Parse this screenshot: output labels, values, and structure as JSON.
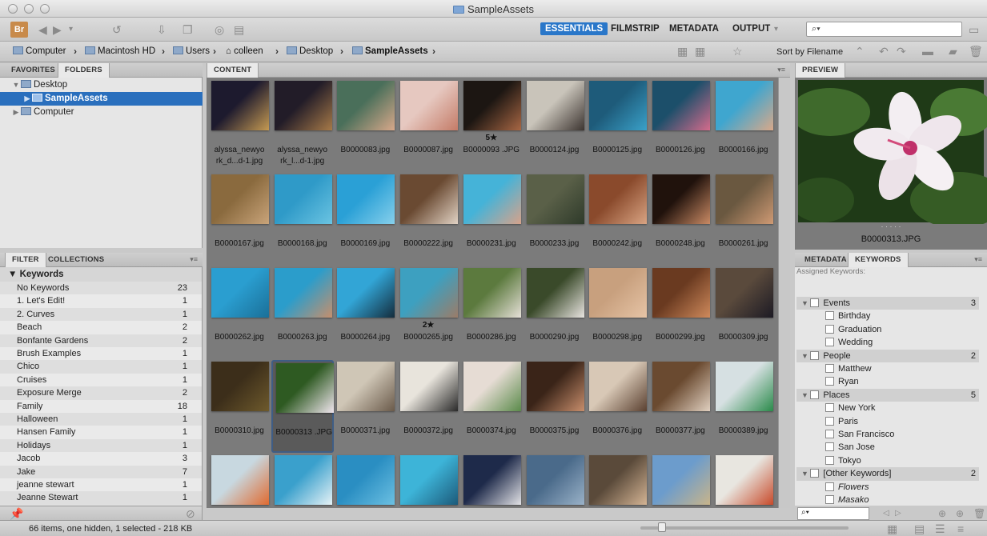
{
  "window": {
    "title": "SampleAssets"
  },
  "toolbar": {
    "workspaces": [
      "ESSENTIALS",
      "FILMSTRIP",
      "METADATA",
      "OUTPUT"
    ],
    "active_workspace": "ESSENTIALS",
    "search_placeholder": "⌕▾",
    "logo": "Br"
  },
  "path": {
    "crumbs": [
      "Computer",
      "Macintosh HD",
      "Users",
      "colleen",
      "Desktop",
      "SampleAssets"
    ],
    "sort_label": "Sort by Filename"
  },
  "left_top": {
    "tabs": [
      "FAVORITES",
      "FOLDERS"
    ],
    "active_tab": "FOLDERS",
    "tree": [
      {
        "label": "Desktop",
        "depth": 1,
        "expanded": true
      },
      {
        "label": "SampleAssets",
        "depth": 2,
        "selected": true
      },
      {
        "label": "Computer",
        "depth": 1,
        "expanded": false
      }
    ]
  },
  "left_bottom": {
    "tabs": [
      "FILTER",
      "COLLECTIONS"
    ],
    "active_tab": "FILTER",
    "heading": "Keywords",
    "rows": [
      {
        "label": "No Keywords",
        "count": "23"
      },
      {
        "label": "1. Let's Edit!",
        "count": "1"
      },
      {
        "label": "2. Curves",
        "count": "1"
      },
      {
        "label": "Beach",
        "count": "2"
      },
      {
        "label": "Bonfante Gardens",
        "count": "2"
      },
      {
        "label": "Brush Examples",
        "count": "1"
      },
      {
        "label": "Chico",
        "count": "1"
      },
      {
        "label": "Cruises",
        "count": "1"
      },
      {
        "label": "Exposure Merge",
        "count": "2"
      },
      {
        "label": "Family",
        "count": "18"
      },
      {
        "label": "Halloween",
        "count": "1"
      },
      {
        "label": "Hansen Family",
        "count": "1"
      },
      {
        "label": "Holidays",
        "count": "1"
      },
      {
        "label": "Jacob",
        "count": "3"
      },
      {
        "label": "Jake",
        "count": "7"
      },
      {
        "label": "jeanne stewart",
        "count": "1"
      },
      {
        "label": "Jeanne Stewart",
        "count": "1"
      }
    ]
  },
  "content": {
    "tab": "CONTENT",
    "items": [
      {
        "name": "alyssa_newyo rk_d...d-1.jpg",
        "colors": [
          "#1d1a2e",
          "#c59a52"
        ],
        "stars": ""
      },
      {
        "name": "alyssa_newyo rk_l...d-1.jpg",
        "colors": [
          "#221c28",
          "#a77a48"
        ],
        "stars": ""
      },
      {
        "name": "B0000083.jpg",
        "colors": [
          "#4a6f5a",
          "#d8a88a"
        ],
        "stars": ""
      },
      {
        "name": "B0000087.jpg",
        "colors": [
          "#e6c8c0",
          "#c47b67"
        ],
        "stars": ""
      },
      {
        "name": "B0000093 .JPG",
        "colors": [
          "#1c1612",
          "#a86744"
        ],
        "stars": "5★"
      },
      {
        "name": "B0000124.jpg",
        "colors": [
          "#c9c4ba",
          "#3c3430"
        ],
        "stars": ""
      },
      {
        "name": "B0000125.jpg",
        "colors": [
          "#1e5b7a",
          "#3aa1c9"
        ],
        "stars": ""
      },
      {
        "name": "B0000126.jpg",
        "colors": [
          "#1c4f6a",
          "#d46b8c"
        ],
        "stars": ""
      },
      {
        "name": "B0000166.jpg",
        "colors": [
          "#3fa6cf",
          "#d9a889"
        ],
        "stars": ""
      },
      {
        "name": "B0000167.jpg",
        "colors": [
          "#8a6a3e",
          "#c9a47a"
        ],
        "stars": ""
      },
      {
        "name": "B0000168.jpg",
        "colors": [
          "#2f9ac8",
          "#6bc4e2"
        ],
        "stars": ""
      },
      {
        "name": "B0000169.jpg",
        "colors": [
          "#2aa0d6",
          "#87d0ec"
        ],
        "stars": ""
      },
      {
        "name": "B0000222.jpg",
        "colors": [
          "#6a4a32",
          "#e1d2c4"
        ],
        "stars": ""
      },
      {
        "name": "B0000231.jpg",
        "colors": [
          "#45b3d8",
          "#d7a28a"
        ],
        "stars": ""
      },
      {
        "name": "B0000233.jpg",
        "colors": [
          "#5a6048",
          "#2e3a2a"
        ],
        "stars": ""
      },
      {
        "name": "B0000242.jpg",
        "colors": [
          "#8a4a2c",
          "#d9a483"
        ],
        "stars": ""
      },
      {
        "name": "B0000248.jpg",
        "colors": [
          "#20120c",
          "#c98a64"
        ],
        "stars": ""
      },
      {
        "name": "B0000261.jpg",
        "colors": [
          "#6a5840",
          "#cf9a74"
        ],
        "stars": ""
      },
      {
        "name": "B0000262.jpg",
        "colors": [
          "#2a9ed0",
          "#1a6f98"
        ],
        "stars": ""
      },
      {
        "name": "B0000263.jpg",
        "colors": [
          "#2b9dcb",
          "#c68f6c"
        ],
        "stars": ""
      },
      {
        "name": "B0000264.jpg",
        "colors": [
          "#32a5d6",
          "#142c3c"
        ],
        "stars": ""
      },
      {
        "name": "B0000265.jpg",
        "colors": [
          "#3da0c0",
          "#9b7c68"
        ],
        "stars": "2★"
      },
      {
        "name": "B0000286.jpg",
        "colors": [
          "#5c7a3e",
          "#e6e0d8"
        ],
        "stars": ""
      },
      {
        "name": "B0000290.jpg",
        "colors": [
          "#3a4a2a",
          "#e8e4e0"
        ],
        "stars": ""
      },
      {
        "name": "B0000298.jpg",
        "colors": [
          "#c8a07e",
          "#e6c4a6"
        ],
        "stars": ""
      },
      {
        "name": "B0000299.jpg",
        "colors": [
          "#6a3a20",
          "#cf8a5c"
        ],
        "stars": ""
      },
      {
        "name": "B0000309.jpg",
        "colors": [
          "#5a4a3c",
          "#1c1a24"
        ],
        "stars": ""
      },
      {
        "name": "B0000310.jpg",
        "colors": [
          "#3c2e1a",
          "#6e5a2c"
        ],
        "stars": ""
      },
      {
        "name": "B0000313 .JPG",
        "colors": [
          "#2e5a22",
          "#f0e6ee"
        ],
        "stars": "",
        "selected": true
      },
      {
        "name": "B0000371.jpg",
        "colors": [
          "#cfc6b6",
          "#6a5a4a"
        ],
        "stars": ""
      },
      {
        "name": "B0000372.jpg",
        "colors": [
          "#e8e4dc",
          "#2a2a2a"
        ],
        "stars": ""
      },
      {
        "name": "B0000374.jpg",
        "colors": [
          "#e6dcd4",
          "#5a8a4a"
        ],
        "stars": ""
      },
      {
        "name": "B0000375.jpg",
        "colors": [
          "#3a2418",
          "#c88e6c"
        ],
        "stars": ""
      },
      {
        "name": "B0000376.jpg",
        "colors": [
          "#d8c8b6",
          "#5a4030"
        ],
        "stars": ""
      },
      {
        "name": "B0000377.jpg",
        "colors": [
          "#6a4a30",
          "#e0d0c0"
        ],
        "stars": ""
      },
      {
        "name": "B0000389.jpg",
        "colors": [
          "#d6e0e2",
          "#2a8a4a"
        ],
        "stars": ""
      },
      {
        "name": "",
        "colors": [
          "#c8d8e0",
          "#e06a30"
        ],
        "stars": ""
      },
      {
        "name": "",
        "colors": [
          "#3aa0cc",
          "#e6f2f6"
        ],
        "stars": ""
      },
      {
        "name": "",
        "colors": [
          "#2a8ec2",
          "#6cc0e2"
        ],
        "stars": ""
      },
      {
        "name": "",
        "colors": [
          "#3db4d8",
          "#1c5a7a"
        ],
        "stars": ""
      },
      {
        "name": "",
        "colors": [
          "#1e2a4a",
          "#e2e2e6"
        ],
        "stars": ""
      },
      {
        "name": "",
        "colors": [
          "#4a6a8a",
          "#9ab2c8"
        ],
        "stars": ""
      },
      {
        "name": "",
        "colors": [
          "#5a4a3a",
          "#d4b494"
        ],
        "stars": ""
      },
      {
        "name": "",
        "colors": [
          "#6c9ccc",
          "#c8b48a"
        ],
        "stars": ""
      },
      {
        "name": "",
        "colors": [
          "#e8e6e0",
          "#c84a2a"
        ],
        "stars": ""
      }
    ]
  },
  "preview": {
    "tab": "PREVIEW",
    "filename": "B0000313.JPG",
    "dots": "· · · · ·"
  },
  "right_bottom": {
    "tabs": [
      "METADATA",
      "KEYWORDS"
    ],
    "active_tab": "KEYWORDS",
    "assigned_label": "Assigned Keywords:",
    "rows": [
      {
        "label": "Events",
        "count": "3",
        "cat": true
      },
      {
        "label": "Birthday",
        "cat": false
      },
      {
        "label": "Graduation",
        "cat": false
      },
      {
        "label": "Wedding",
        "cat": false
      },
      {
        "label": "People",
        "count": "2",
        "cat": true
      },
      {
        "label": "Matthew",
        "cat": false
      },
      {
        "label": "Ryan",
        "cat": false
      },
      {
        "label": "Places",
        "count": "5",
        "cat": true
      },
      {
        "label": "New York",
        "cat": false
      },
      {
        "label": "Paris",
        "cat": false
      },
      {
        "label": "San Francisco",
        "cat": false
      },
      {
        "label": "San Jose",
        "cat": false
      },
      {
        "label": "Tokyo",
        "cat": false
      },
      {
        "label": "[Other Keywords]",
        "count": "2",
        "cat": true
      },
      {
        "label": "Flowers",
        "cat": false,
        "italic": true
      },
      {
        "label": "Masako",
        "cat": false,
        "italic": true
      }
    ],
    "search_placeholder": "⌕▾"
  },
  "status": {
    "text": "66 items, one hidden, 1 selected - 218 KB"
  }
}
